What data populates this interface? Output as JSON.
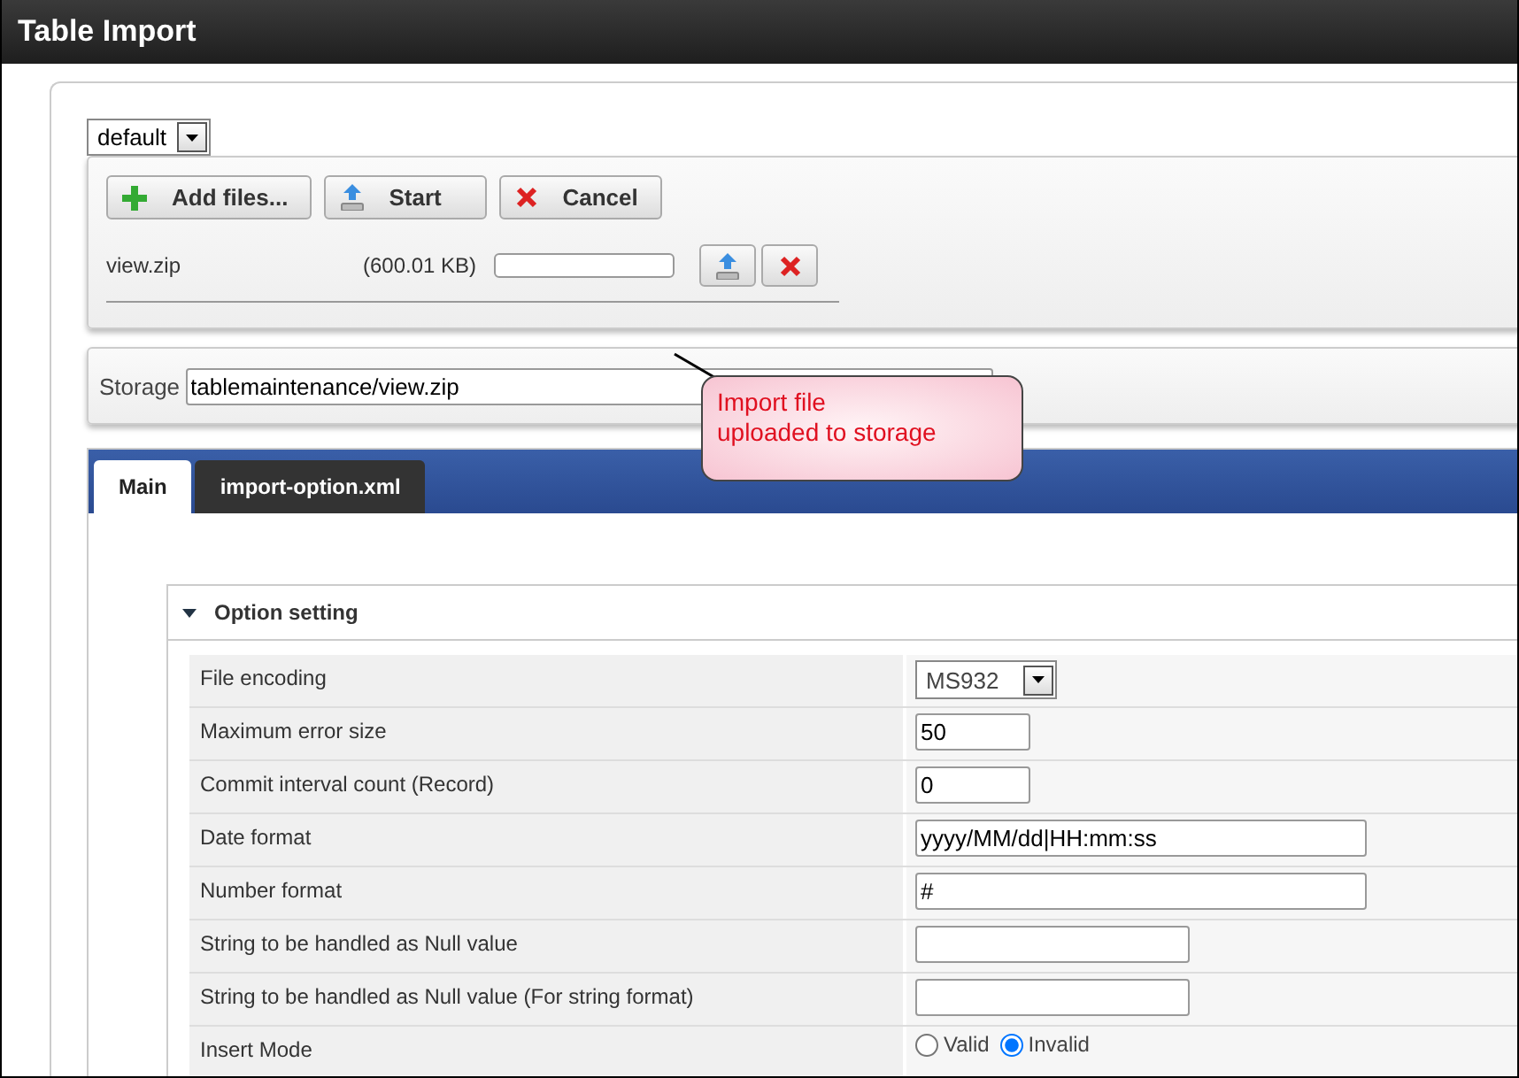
{
  "window": {
    "title": "Table Import"
  },
  "profile_select": {
    "value": "default"
  },
  "uploader": {
    "buttons": [
      {
        "kind": "add",
        "label": "Add files..."
      },
      {
        "kind": "start",
        "label": "Start"
      },
      {
        "kind": "cancel",
        "label": "Cancel"
      }
    ],
    "files": [
      {
        "name": "view.zip",
        "size": "(600.01 KB)",
        "level": 0
      }
    ]
  },
  "storage": {
    "label": "Storage",
    "value": "tablemaintenance/view.zip"
  },
  "callout": {
    "text": "Import file\nuploaded to storage"
  },
  "tabs": [
    {
      "label": "Main",
      "selected": true
    },
    {
      "label": "import-option.xml",
      "selected": false
    }
  ],
  "section": {
    "title": "Option setting",
    "expanded": true,
    "rows": [
      {
        "label": "File encoding",
        "kind": "select",
        "value": "MS932"
      },
      {
        "label": "Maximum error size",
        "kind": "short",
        "value": "50"
      },
      {
        "label": "Commit interval count (Record)",
        "kind": "short",
        "value": "0"
      },
      {
        "label": "Date format",
        "kind": "long",
        "value": "yyyy/MM/dd|HH:mm:ss"
      },
      {
        "label": "Number format",
        "kind": "long",
        "value": "#"
      },
      {
        "label": "String to be handled as Null value",
        "kind": "medium",
        "value": ""
      },
      {
        "label": "String to be handled as Null value (For string format)",
        "kind": "medium",
        "value": ""
      },
      {
        "label": "Insert Mode",
        "kind": "radio",
        "options": [
          {
            "label": "Valid",
            "selected": false
          },
          {
            "label": "Invalid",
            "selected": true
          }
        ]
      }
    ]
  }
}
